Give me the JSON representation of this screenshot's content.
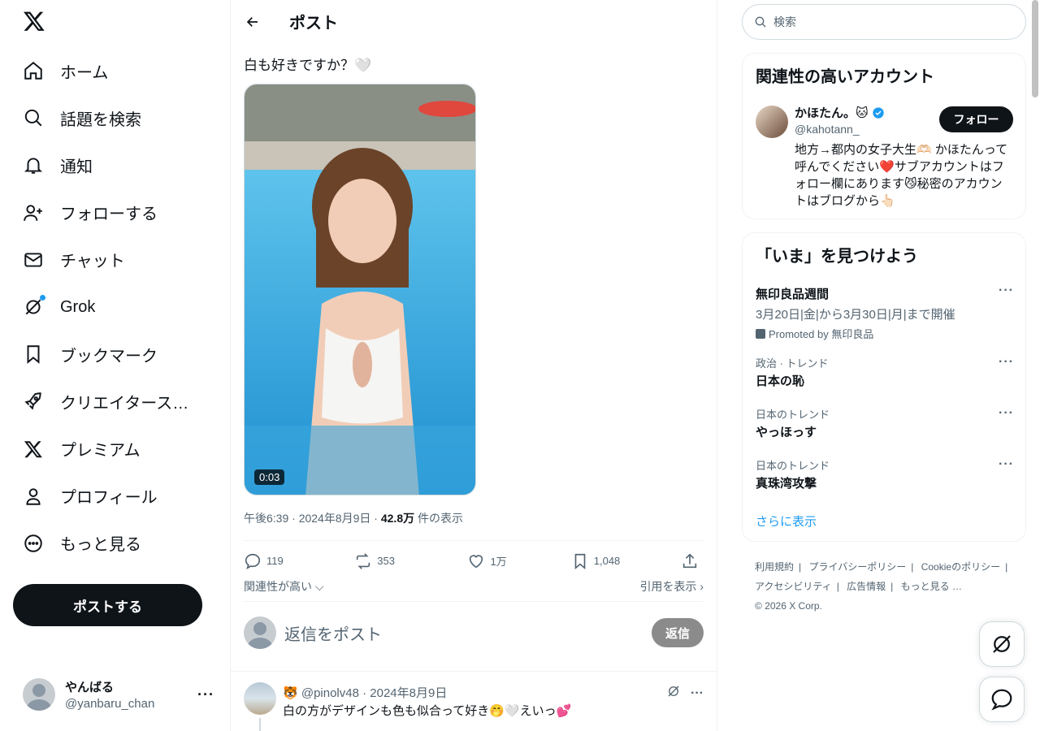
{
  "nav": {
    "items": [
      {
        "label": "ホーム",
        "icon": "home-icon"
      },
      {
        "label": "話題を検索",
        "icon": "search-icon"
      },
      {
        "label": "通知",
        "icon": "bell-icon"
      },
      {
        "label": "フォローする",
        "icon": "person-add-icon"
      },
      {
        "label": "チャット",
        "icon": "mail-icon"
      },
      {
        "label": "Grok",
        "icon": "grok-icon"
      },
      {
        "label": "ブックマーク",
        "icon": "bookmark-icon"
      },
      {
        "label": "クリエイタースタ…",
        "icon": "rocket-icon"
      },
      {
        "label": "プレミアム",
        "icon": "x-logo-icon"
      },
      {
        "label": "プロフィール",
        "icon": "person-icon"
      },
      {
        "label": "もっと見る",
        "icon": "more-circle-icon"
      }
    ],
    "post_button": "ポストする"
  },
  "account": {
    "name": "やんばる",
    "handle": "@yanbaru_chan",
    "more": "···"
  },
  "header": {
    "title": "ポスト"
  },
  "tweet": {
    "text": "白も好きですか？🤍",
    "duration": "0:03",
    "time": "午後6:39 · 2024年8月9日 · ",
    "views": "42.8万",
    "views_suffix": " 件の表示",
    "stats": {
      "replies": "119",
      "retweets": "353",
      "likes": "1万",
      "bookmarks": "1,048"
    },
    "sort_label": "関連性が高い",
    "quotes_label": "引用を表示"
  },
  "reply_composer": {
    "placeholder": "返信をポスト",
    "button": "返信"
  },
  "first_reply": {
    "header": "🐯 @pinolv48 · 2024年8月9日",
    "text": "白の方がデザインも色も似合って好き🤭🤍えいっ💕",
    "more": "···"
  },
  "search": {
    "placeholder": "検索"
  },
  "related": {
    "title": "関連性の高いアカウント",
    "account": {
      "name": "かほたん。🐱",
      "handle": "@kahotann_",
      "follow": "フォロー",
      "bio": "地方→都内の女子大生🫶🏻 かほたんって呼んでください❤️サブアカウントはフォロー欄にあります😼秘密のアカウントはブログから👆🏻"
    }
  },
  "trends": {
    "title": "「いま」を見つけよう",
    "items": [
      {
        "context": "",
        "name": "無印良品週間",
        "sub": "3月20日|金|から3月30日|月|まで開催",
        "promo": "Promoted by 無印良品"
      },
      {
        "context": "政治 · トレンド",
        "name": "日本の恥"
      },
      {
        "context": "日本のトレンド",
        "name": "やっほっす"
      },
      {
        "context": "日本のトレンド",
        "name": "真珠湾攻撃"
      }
    ],
    "more_symbol": "···",
    "show_more": "さらに表示"
  },
  "footer": {
    "links": [
      "利用規約",
      "プライバシーポリシー",
      "Cookieのポリシー",
      "アクセシビリティ",
      "広告情報",
      "もっと見る …"
    ],
    "copyright": "© 2026 X Corp."
  },
  "colors": {
    "accent": "#1d9bf0",
    "text": "#0f1419",
    "muted": "#536471"
  }
}
